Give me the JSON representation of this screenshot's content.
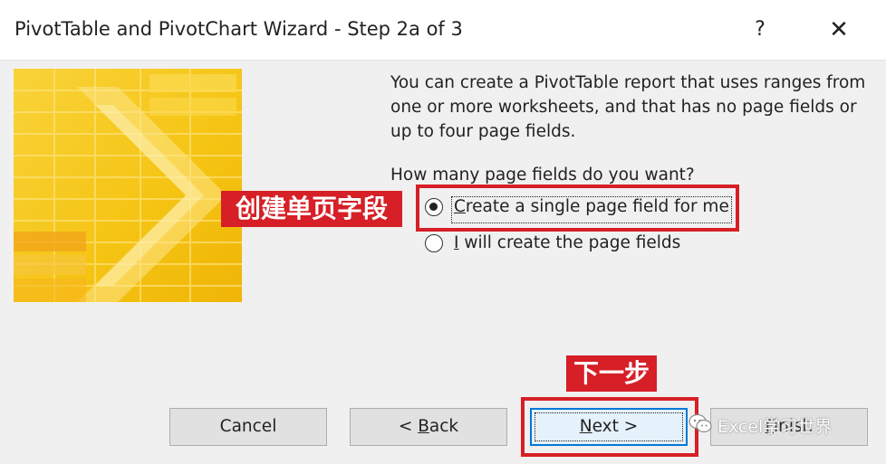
{
  "window": {
    "title": "PivotTable and PivotChart Wizard - Step 2a of 3",
    "help_label": "?",
    "close_label": "✕"
  },
  "main": {
    "description": "You can create a PivotTable report that uses ranges from one or more worksheets, and that has no page fields or up to four page fields.",
    "question": "How many page fields do you want?",
    "options": [
      {
        "accel": "C",
        "rest": "reate a single page field for me",
        "selected": true
      },
      {
        "accel": "I",
        "rest": " will create the page fields",
        "selected": false
      }
    ]
  },
  "buttons": {
    "cancel": {
      "label": "Cancel"
    },
    "back": {
      "prefix": "< ",
      "accel": "B",
      "rest": "ack"
    },
    "next": {
      "accel": "N",
      "rest": "ext >"
    },
    "finish": {
      "accel": "F",
      "rest": "inish"
    }
  },
  "annotations": {
    "option_label": "创建单页字段",
    "next_label": "下一步",
    "color": "#d61f26"
  },
  "watermark": {
    "text": "Excel学习世界",
    "icon": "wechat-icon"
  },
  "colors": {
    "art_yellow": "#f7c81e",
    "default_button_border": "#0078d7"
  }
}
